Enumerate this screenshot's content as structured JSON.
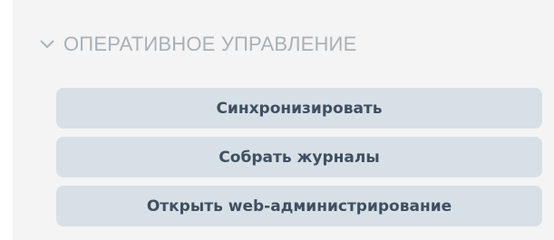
{
  "section": {
    "icon": "chevron-down-icon",
    "title": "ОПЕРАТИВНОЕ УПРАВЛЕНИЕ",
    "title_color": "#a9b1b8"
  },
  "actions": [
    {
      "label": "Синхронизировать"
    },
    {
      "label": "Собрать журналы"
    },
    {
      "label": "Открыть web-администрирование"
    }
  ],
  "colors": {
    "panel_bg": "#f4f4f4",
    "button_bg": "#d7e0e7",
    "button_text": "#3f4f60"
  }
}
